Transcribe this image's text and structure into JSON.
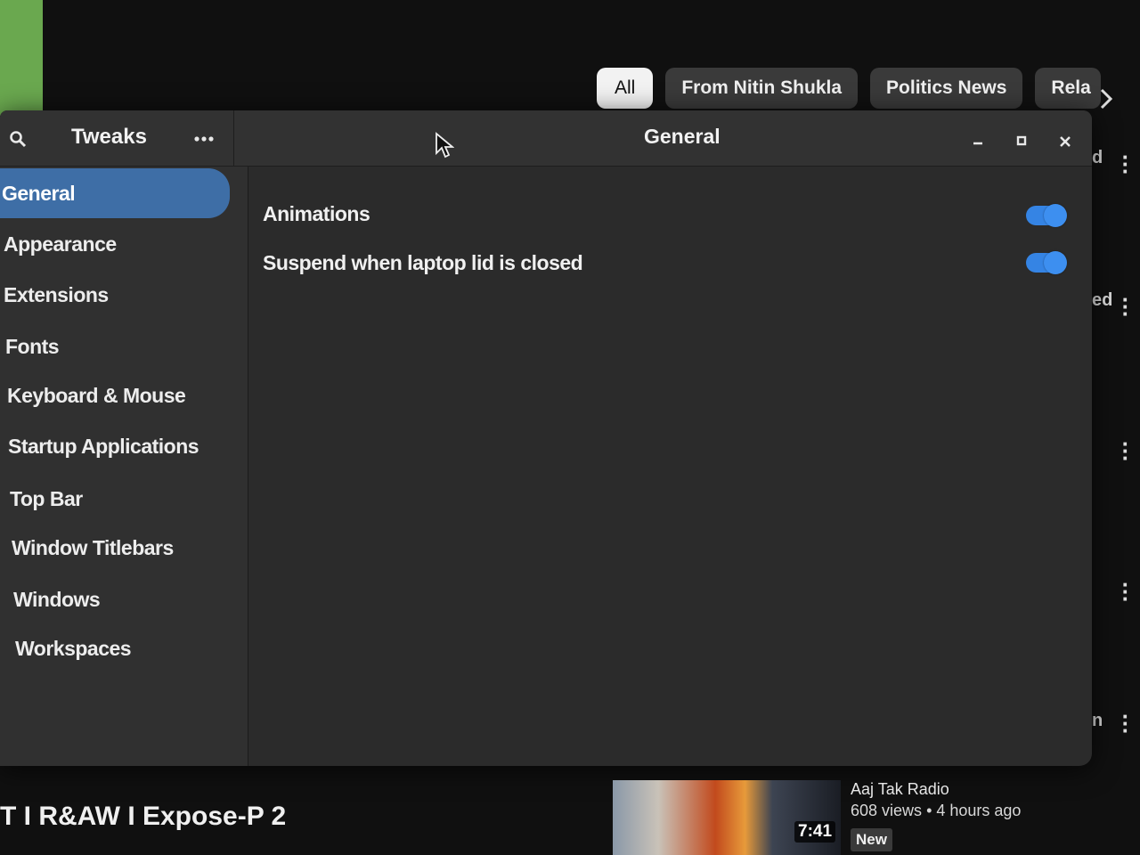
{
  "youtube": {
    "chips": [
      "All",
      "From Nitin Shukla",
      "Politics News",
      "Rela"
    ],
    "side_fragments": [
      "d",
      "ed",
      "n"
    ],
    "bottom": {
      "video_title": "T I R&AW I Expose-P 2",
      "duration": "7:41",
      "channel": "Aaj Tak Radio",
      "views": "608 views",
      "age": "4 hours ago",
      "badge": "New"
    }
  },
  "window": {
    "app_title": "Tweaks",
    "page_title": "General",
    "sidebar": {
      "items": [
        {
          "label": "General",
          "selected": true
        },
        {
          "label": "Appearance",
          "selected": false
        },
        {
          "label": "Extensions",
          "selected": false
        },
        {
          "label": "Fonts",
          "selected": false
        },
        {
          "label": "Keyboard & Mouse",
          "selected": false
        },
        {
          "label": "Startup Applications",
          "selected": false
        },
        {
          "label": "Top Bar",
          "selected": false
        },
        {
          "label": "Window Titlebars",
          "selected": false
        },
        {
          "label": "Windows",
          "selected": false
        },
        {
          "label": "Workspaces",
          "selected": false
        }
      ]
    },
    "settings": [
      {
        "label": "Animations",
        "enabled": true
      },
      {
        "label": "Suspend when laptop lid is closed",
        "enabled": true
      }
    ],
    "accent": "#3584e4",
    "selection_color": "#3e6ea6"
  }
}
